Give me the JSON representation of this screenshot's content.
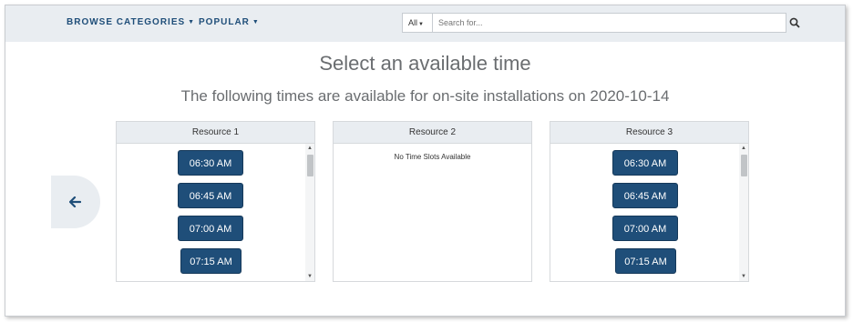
{
  "nav": {
    "browse_label": "BROWSE CATEGORIES",
    "popular_label": "POPULAR"
  },
  "search": {
    "scope_value": "All",
    "placeholder": "Search for...",
    "icon": "search-icon"
  },
  "main": {
    "title": "Select an available time",
    "subtitle": "The following times are available for on-site installations on 2020-10-14"
  },
  "back_button": {
    "icon": "arrow-left-icon"
  },
  "resources": [
    {
      "name": "Resource 1",
      "slots": [
        "06:30 AM",
        "06:45 AM",
        "07:00 AM",
        "07:15 AM"
      ]
    },
    {
      "name": "Resource 2",
      "empty_message": "No Time Slots Available"
    },
    {
      "name": "Resource 3",
      "slots": [
        "06:30 AM",
        "06:45 AM",
        "07:00 AM",
        "07:15 AM"
      ]
    }
  ],
  "colors": {
    "accent": "#1f4e79",
    "bar_background": "#e9edf1",
    "heading_text": "#6a6d70"
  }
}
